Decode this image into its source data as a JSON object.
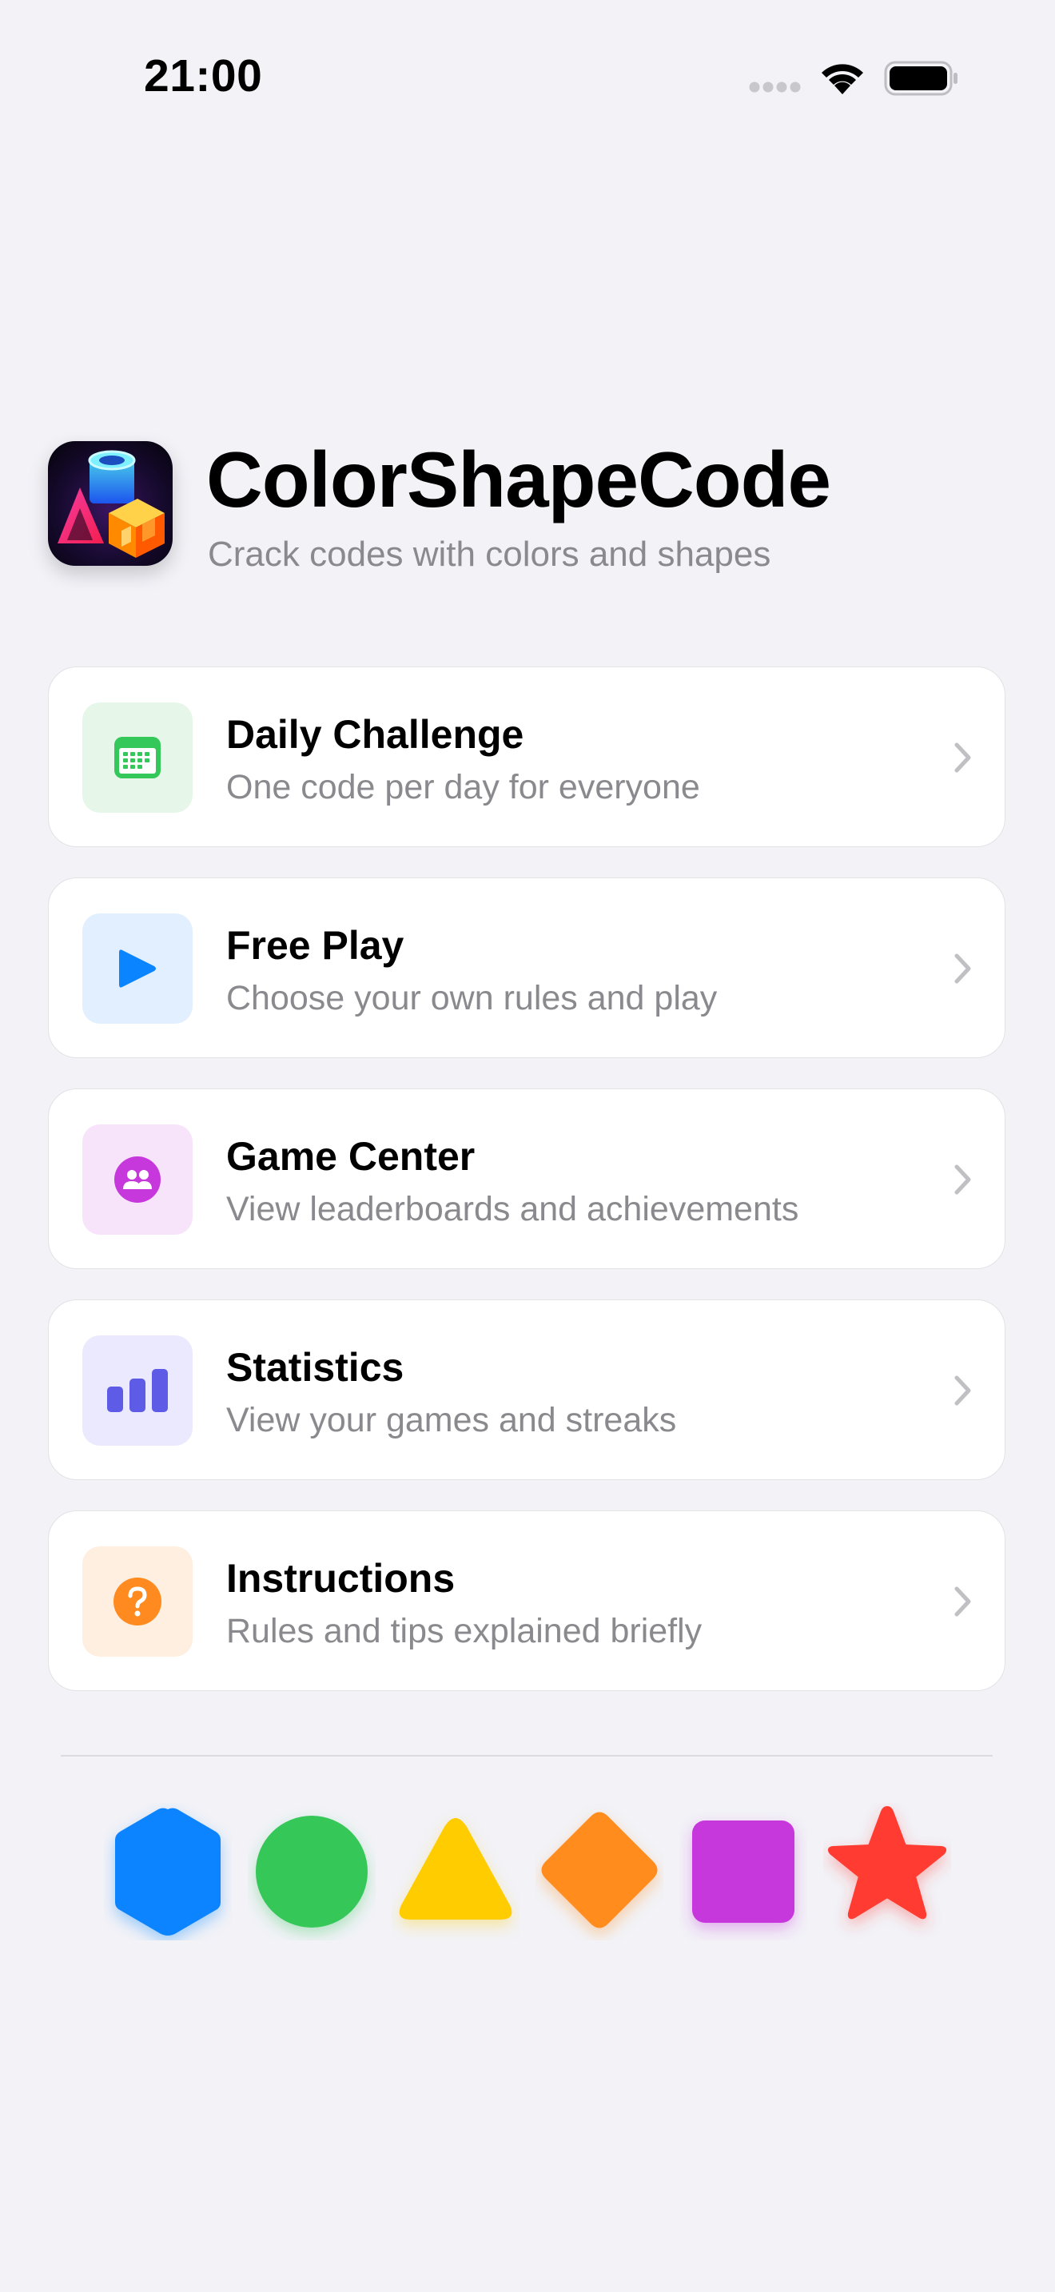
{
  "status_bar": {
    "time": "21:00",
    "icons": [
      "cellular-signal-icon",
      "wifi-icon",
      "battery-icon"
    ]
  },
  "header": {
    "icon": "app-icon",
    "title": "ColorShapeCode",
    "subtitle": "Crack codes with colors and shapes"
  },
  "menu": {
    "items": [
      {
        "title": "Daily Challenge",
        "subtitle": "One code per day for everyone",
        "icon": "calendar-icon",
        "color": "#34C759",
        "bg": "#E6F7EA"
      },
      {
        "title": "Free Play",
        "subtitle": "Choose your own rules and play",
        "icon": "play-icon",
        "color": "#0A84FF",
        "bg": "#E1EFFE"
      },
      {
        "title": "Game Center",
        "subtitle": "View leaderboards and achievements",
        "icon": "people-icon",
        "color": "#C638DC",
        "bg": "#F7E4FA"
      },
      {
        "title": "Statistics",
        "subtitle": "View your games and streaks",
        "icon": "bar-chart-icon",
        "color": "#5E5CE6",
        "bg": "#EAE9FD"
      },
      {
        "title": "Instructions",
        "subtitle": "Rules and tips explained briefly",
        "icon": "question-icon",
        "color": "#FF8A1F",
        "bg": "#FFEFE1"
      }
    ]
  },
  "shapes": [
    {
      "name": "hexagon-shape",
      "color": "#0A84FF"
    },
    {
      "name": "circle-shape",
      "color": "#34C759"
    },
    {
      "name": "triangle-shape",
      "color": "#FFCC00"
    },
    {
      "name": "diamond-shape",
      "color": "#FF8C1F"
    },
    {
      "name": "square-shape",
      "color": "#C638DC"
    },
    {
      "name": "star-shape",
      "color": "#FF3B30"
    }
  ]
}
